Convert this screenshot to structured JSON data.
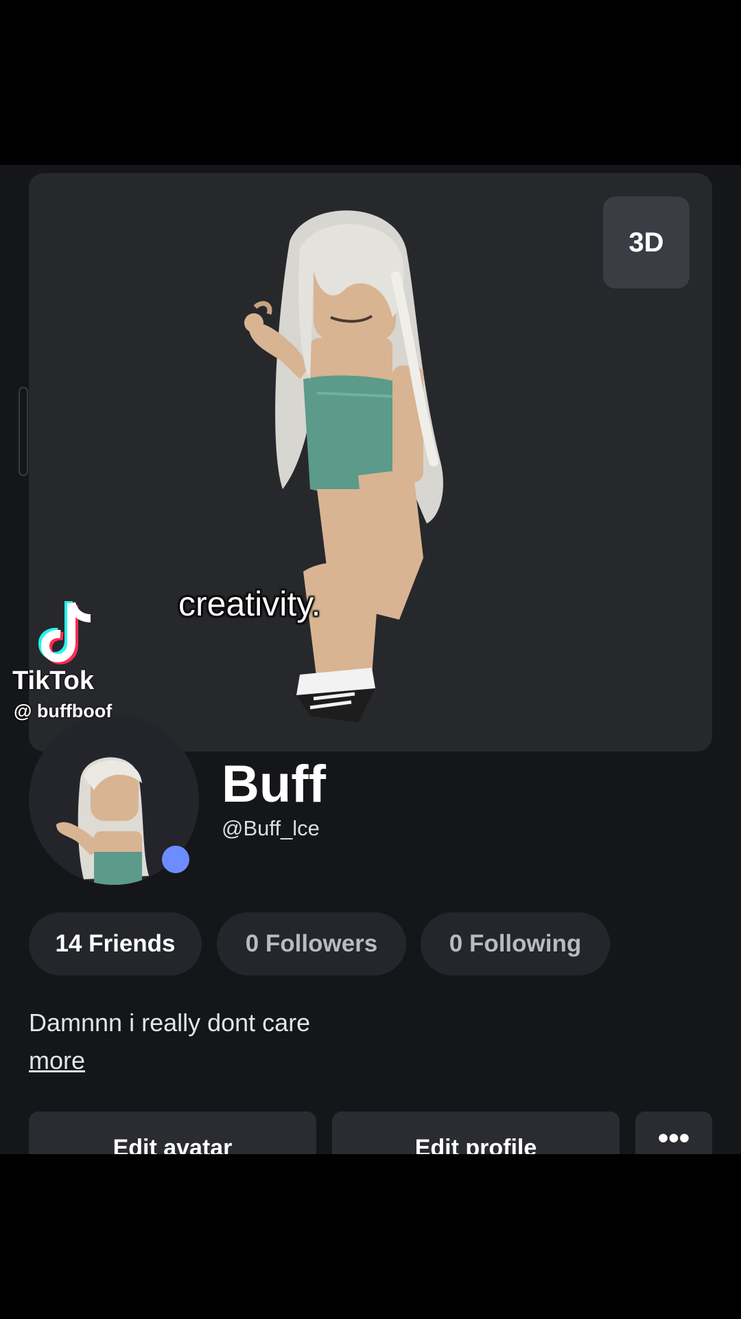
{
  "stage": {
    "view_toggle_label": "3D",
    "caption": "creativity."
  },
  "watermark": {
    "app_name": "TikTok",
    "handle": "@ buffboof"
  },
  "profile": {
    "display_name": "Buff",
    "username": "@Buff_lce",
    "status": "online",
    "status_color": "#6d8cff",
    "bio": "Damnnn i really dont care",
    "more_label": "more"
  },
  "stats": {
    "friends": "14 Friends",
    "followers": "0 Followers",
    "following": "0 Following"
  },
  "actions": {
    "edit_avatar": "Edit avatar",
    "edit_profile": "Edit profile",
    "more_options": "•••"
  }
}
